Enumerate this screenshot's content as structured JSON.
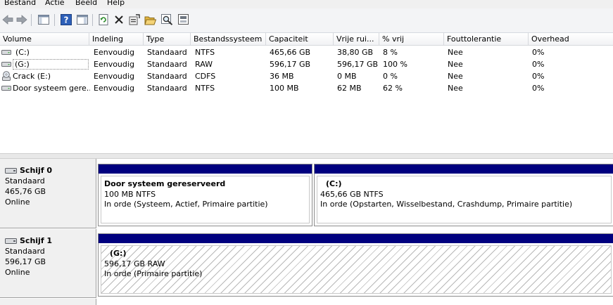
{
  "menu": [
    "Bestand",
    "Actie",
    "Beeld",
    "Help"
  ],
  "columns": [
    "Volume",
    "Indeling",
    "Type",
    "Bestandssysteem",
    "Capaciteit",
    "Vrije rui...",
    "% vrij",
    "Fouttolerantie",
    "Overhead"
  ],
  "volumes": [
    {
      "name": "(C:)",
      "layout": "Eenvoudig",
      "type": "Standaard",
      "fs": "NTFS",
      "capacity": "465,66 GB",
      "free": "38,80 GB",
      "pct_free": "8 %",
      "fault": "Nee",
      "overhead": "0%",
      "icon": "drive-icon"
    },
    {
      "name": "(G:)",
      "layout": "Eenvoudig",
      "type": "Standaard",
      "fs": "RAW",
      "capacity": "596,17 GB",
      "free": "596,17 GB",
      "pct_free": "100 %",
      "fault": "Nee",
      "overhead": "0%",
      "icon": "drive-icon"
    },
    {
      "name": "Crack (E:)",
      "layout": "Eenvoudig",
      "type": "Standaard",
      "fs": "CDFS",
      "capacity": "36 MB",
      "free": "0 MB",
      "pct_free": "0 %",
      "fault": "Nee",
      "overhead": "0%",
      "icon": "cd-drive-icon"
    },
    {
      "name": "Door systeem gere...",
      "layout": "Eenvoudig",
      "type": "Standaard",
      "fs": "NTFS",
      "capacity": "100 MB",
      "free": "62 MB",
      "pct_free": "62 %",
      "fault": "Nee",
      "overhead": "0%",
      "icon": "drive-icon"
    }
  ],
  "disks": [
    {
      "name": "Schijf 0",
      "type": "Standaard",
      "size": "465,76 GB",
      "status": "Online",
      "partitions": [
        {
          "title": "Door systeem gereserveerd",
          "size": "100 MB NTFS",
          "status": "In orde (Systeem, Actief, Primaire partitie)"
        },
        {
          "title": "(C:)",
          "size": "465,66 GB NTFS",
          "status": "In orde (Opstarten, Wisselbestand, Crashdump, Primaire partitie)"
        }
      ]
    },
    {
      "name": "Schijf 1",
      "type": "Standaard",
      "size": "596,17 GB",
      "status": "Online",
      "partitions": [
        {
          "title": "(G:)",
          "size": "596,17 GB RAW",
          "status": "In orde (Primaire partitie)"
        }
      ]
    }
  ],
  "colors": {
    "partition_bar": "#00007f",
    "accent_blue": "#1c5fc4"
  }
}
